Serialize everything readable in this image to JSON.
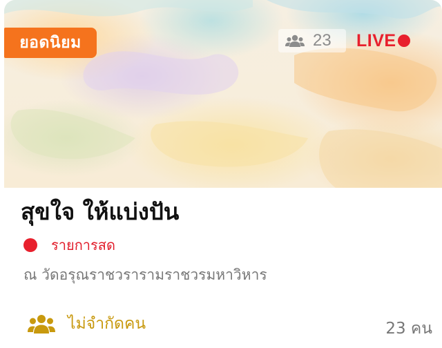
{
  "badge": {
    "label": "ยอดนิยม"
  },
  "viewers": {
    "count": "23",
    "icon": "viewers-icon"
  },
  "live": {
    "label": "LIVE"
  },
  "event": {
    "title": "สุขใจ ให้แบ่งปัน",
    "status": "รายการสด",
    "location": "ณ วัดอรุณราชวรารามราชวรมหาวิหาร",
    "capacity": "ไม่จำกัดคน",
    "participants": "23 คน"
  },
  "colors": {
    "accent": "#f5731d",
    "live_red": "#e8202d",
    "capacity_gold": "#c8990e",
    "muted_text": "#777777"
  }
}
